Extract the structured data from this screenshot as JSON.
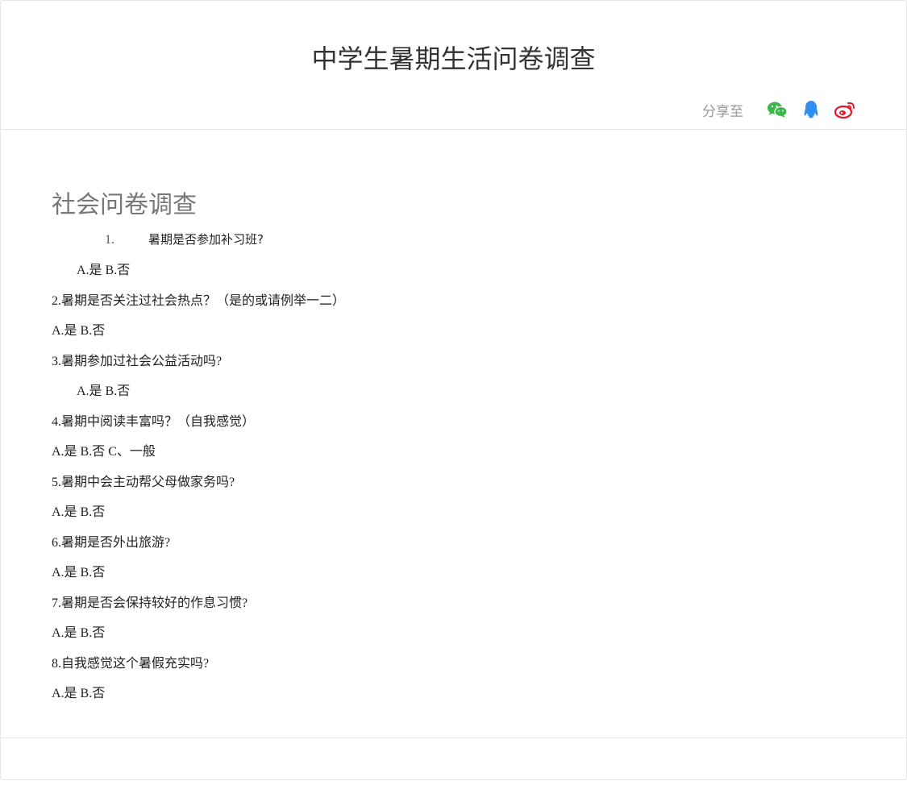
{
  "header": {
    "title": "中学生暑期生活问卷调查",
    "share_label": "分享至",
    "share_icons": [
      "wechat-icon",
      "qq-icon",
      "weibo-icon"
    ]
  },
  "colors": {
    "wechat": "#3db54a",
    "qq": "#2f8ff0",
    "weibo": "#e6162d"
  },
  "survey": {
    "section_title": "社会问卷调查",
    "q1_num": "1.",
    "q1_text": "暑期是否参加补习班?",
    "q1_options": "A.是 B.否",
    "q2_text": "2.暑期是否关注过社会热点？（是的或请例举一二）",
    "q2_options": "A.是 B.否",
    "q3_text": "3.暑期参加过社会公益活动吗?",
    "q3_options": "A.是 B.否",
    "q4_text": "4.暑期中阅读丰富吗？（自我感觉）",
    "q4_options": "A.是 B.否 C、一般",
    "q5_text": "5.暑期中会主动帮父母做家务吗?",
    "q5_options": "A.是 B.否",
    "q6_text": "6.暑期是否外出旅游?",
    "q6_options": "A.是 B.否",
    "q7_text": "7.暑期是否会保持较好的作息习惯?",
    "q7_options": "A.是 B.否",
    "q8_text": "8.自我感觉这个暑假充实吗?",
    "q8_options": "A.是 B.否"
  }
}
